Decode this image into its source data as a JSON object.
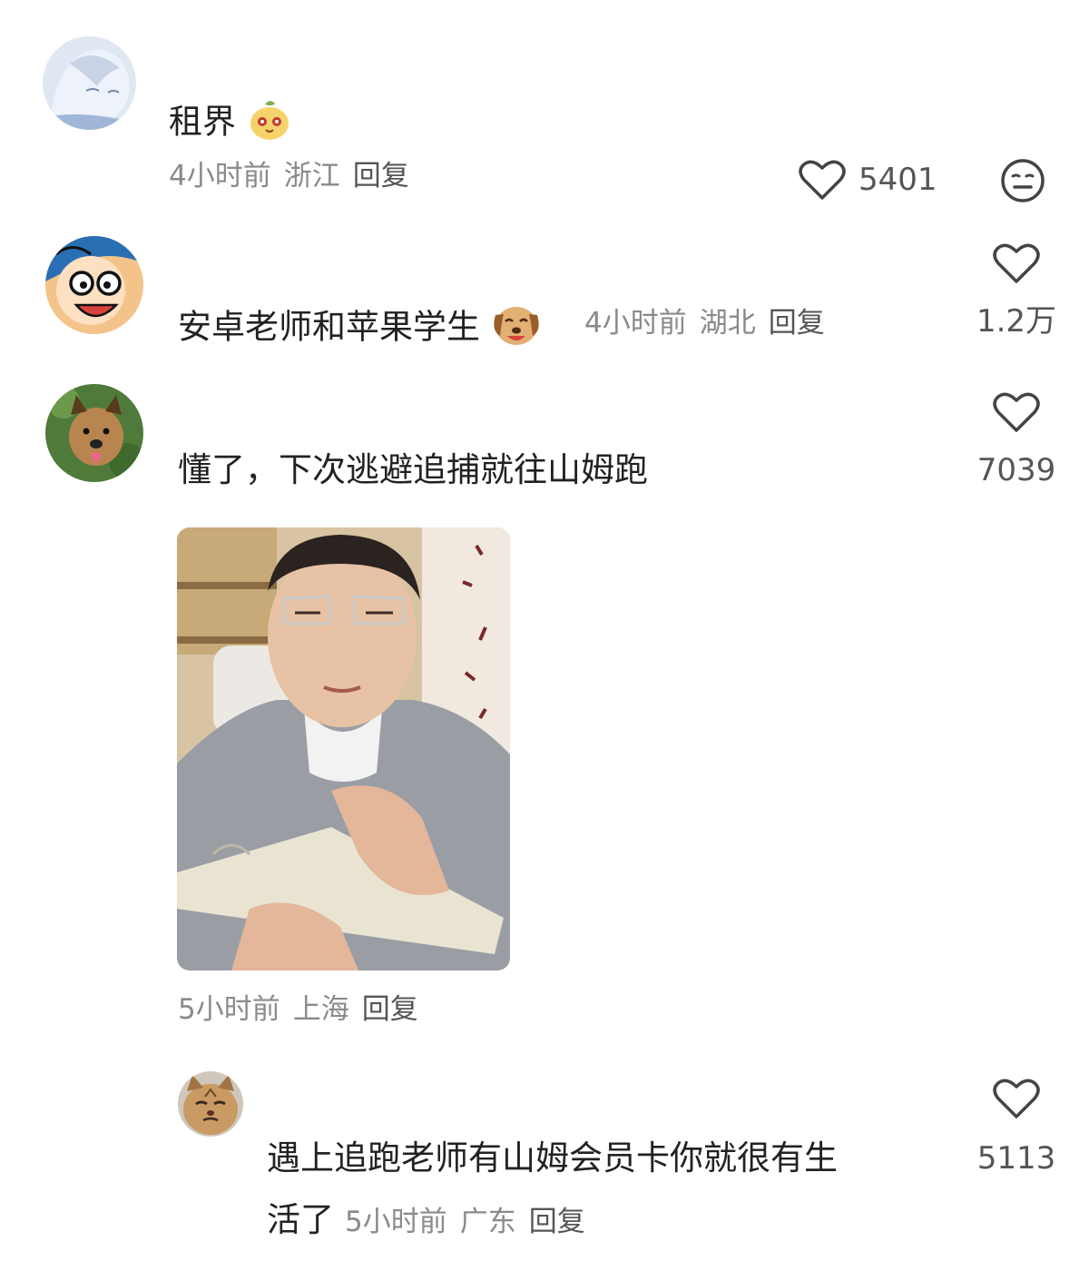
{
  "comments": [
    {
      "text": "租界",
      "emoji": "orange-pudding-emoji",
      "time": "4小时前",
      "location": "浙江",
      "reply": "回复",
      "likes": "5401"
    },
    {
      "text": "安卓老师和苹果学生",
      "emoji": "dog-laughing-emoji",
      "time": "4小时前",
      "location": "湖北",
      "reply": "回复",
      "likes": "1.2万"
    },
    {
      "text": "懂了，下次逃避追捕就往山姆跑",
      "time": "5小时前",
      "location": "上海",
      "reply": "回复",
      "likes": "7039"
    }
  ],
  "reply": {
    "text_line1": "遇上追跑老师有山姆会员卡你就很有生",
    "text_line2": "活了",
    "time": "5小时前",
    "location": "广东",
    "reply": "回复",
    "likes": "5113"
  },
  "icons": {
    "like": "heart-outline-icon",
    "dislike": "neutral-face-icon"
  },
  "colors": {
    "text": "#222222",
    "meta": "#8a8a8a",
    "icon": "#444444"
  }
}
